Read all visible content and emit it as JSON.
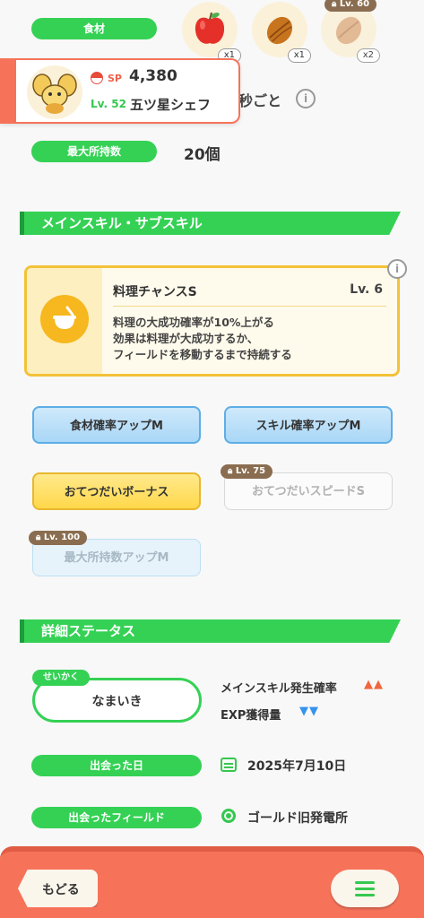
{
  "ingredients": {
    "label": "食材",
    "items": [
      {
        "icon": "apple-icon",
        "qty": "x1"
      },
      {
        "icon": "cacao-icon",
        "qty": "x1"
      },
      {
        "icon": "locked-cacao-icon",
        "qty": "x2",
        "lock_level": "Lv. 60"
      }
    ]
  },
  "pokemon_card": {
    "sp_label": "SP",
    "sp_value": "4,380",
    "level": "Lv. 52",
    "name": "五ツ星シェフ"
  },
  "help_time": {
    "value_partial": "秒ごと"
  },
  "max_carry": {
    "label": "最大所持数",
    "value": "20個"
  },
  "skills_section": {
    "title": "メインスキル・サブスキル"
  },
  "main_skill": {
    "name": "料理チャンスS",
    "level": "Lv. 6",
    "desc1": "料理の大成功確率が10%上がる",
    "desc2": "効果は料理が大成功するか、",
    "desc3": "フィールドを移動するまで持続する"
  },
  "sub_skills": [
    {
      "label": "食材確率アップM"
    },
    {
      "label": "スキル確率アップM"
    },
    {
      "label": "おてつだいボーナス"
    },
    {
      "label": "おてつだいスピードS",
      "lock": "Lv. 75"
    },
    {
      "label": "最大所持数アップM",
      "lock": "Lv. 100"
    }
  ],
  "details_section": {
    "title": "詳細ステータス"
  },
  "nature": {
    "tag": "せいかく",
    "value": "なまいき",
    "up_label": "メインスキル発生確率",
    "up_arrows": "▲▲",
    "down_label": "EXP獲得量",
    "down_arrows": "▼▼"
  },
  "met_date": {
    "label": "出会った日",
    "value": "2025年7月10日"
  },
  "met_field": {
    "label": "出会ったフィールド",
    "value": "ゴールド旧発電所"
  },
  "footer": {
    "back_label": "もどる"
  },
  "colors": {
    "green": "#35d155",
    "orange": "#f6735a",
    "up": "#f1663f",
    "down": "#3592ee"
  }
}
